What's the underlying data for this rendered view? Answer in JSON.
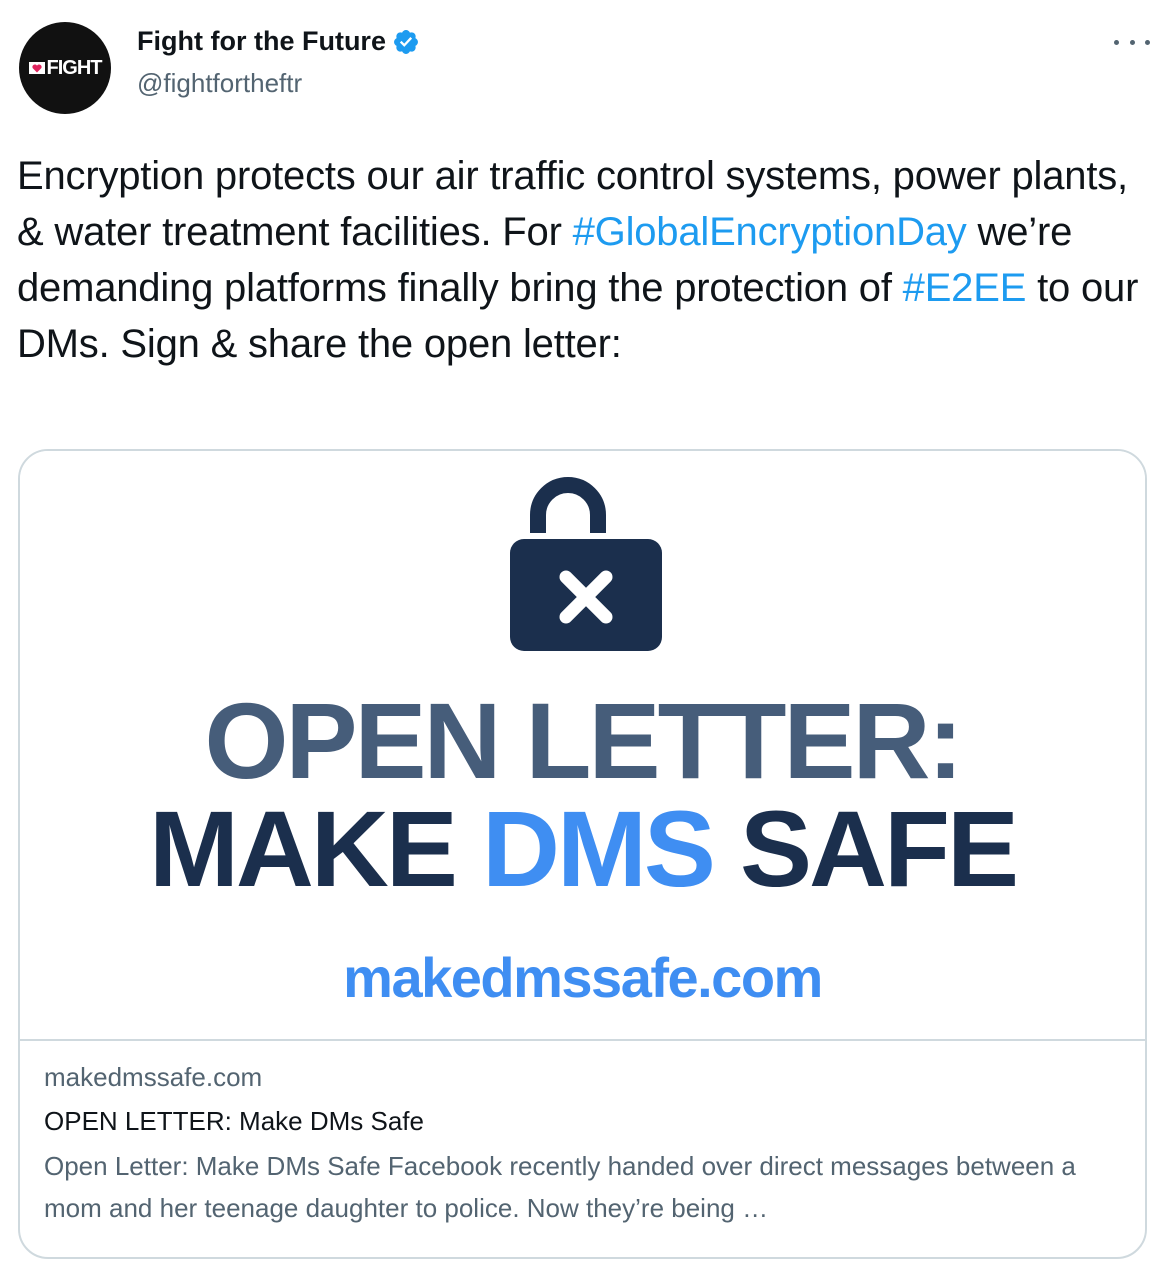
{
  "author": {
    "avatar_text": "FIGHT",
    "display_name": "Fight for the Future",
    "handle": "@fightfortheftr",
    "verified": true
  },
  "tweet": {
    "segments": [
      {
        "text": "Encryption protects our air traffic control systems, power plants, & water treatment facilities. For ",
        "type": "text"
      },
      {
        "text": "#GlobalEncryptionDay",
        "type": "hashtag"
      },
      {
        "text": " we’re demanding platforms finally bring the protection of ",
        "type": "text"
      },
      {
        "text": "#E2EE",
        "type": "hashtag"
      },
      {
        "text": " to our DMs. Sign & share the open letter:",
        "type": "text"
      }
    ]
  },
  "card": {
    "image": {
      "line1": "OPEN LETTER:",
      "line2_a": "MAKE ",
      "line2_accent": "DMS",
      "line2_b": " SAFE",
      "url": "makedmssafe.com"
    },
    "domain": "makedmssafe.com",
    "title": "OPEN LETTER: Make DMs Safe",
    "description": "Open Letter: Make DMs Safe Facebook recently handed over direct messages between a mom and her teenage daughter to police. Now they’re being …"
  },
  "colors": {
    "link": "#1d9bf0",
    "verified": "#1d9bf0",
    "image_navy": "#1b2f4d",
    "image_slate": "#465d7a",
    "image_blue": "#3f8ef2"
  },
  "icons": {
    "verified": "verified-badge-icon",
    "more": "more-horizontal-icon",
    "lock": "unlocked-padlock-x-icon"
  }
}
